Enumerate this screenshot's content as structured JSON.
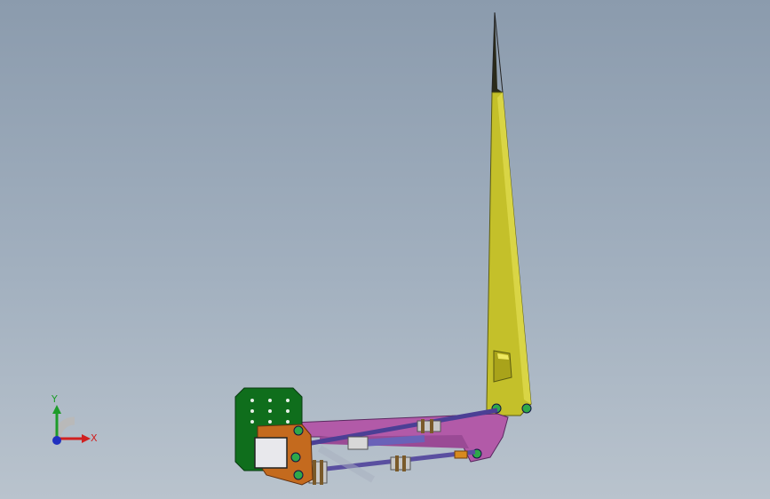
{
  "viewport": {
    "background_top": "#8b9bad",
    "background_bottom": "#b9c3cd"
  },
  "model": {
    "parts": [
      {
        "name": "mounting-plate",
        "color": "#0f6e1c"
      },
      {
        "name": "boom-arm",
        "color": "#c4c02a"
      },
      {
        "name": "link-bracket",
        "color": "#b25aa8"
      },
      {
        "name": "hydraulic-cylinder",
        "color": "#5a4fa0"
      },
      {
        "name": "clevis-bracket",
        "color": "#c46a1e"
      }
    ]
  },
  "triad": {
    "y_label": "Y",
    "x_label": "X",
    "y_color": "#1d9c2a",
    "x_color": "#d02020",
    "z_color": "#2030c0"
  }
}
